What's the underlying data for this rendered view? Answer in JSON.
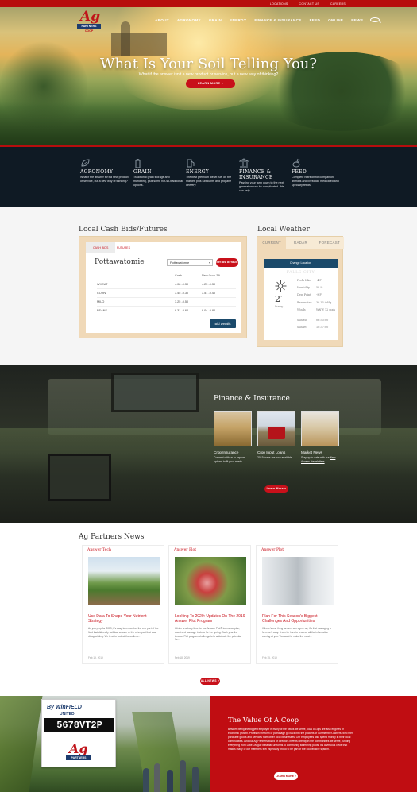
{
  "topbar": {
    "links": [
      "LOCATIONS",
      "CONTACT US",
      "CAREERS"
    ]
  },
  "brand": {
    "logo_text": "Ag",
    "logo_sub_a": "PARTNERS",
    "logo_sub_b": "COOP"
  },
  "nav": {
    "items": [
      "ABOUT",
      "AGRONOMY",
      "GRAIN",
      "ENERGY",
      "FINANCE & INSURANCE",
      "FEED",
      "ONLINE",
      "NEWS"
    ]
  },
  "hero": {
    "title": "What Is Your Soil Telling You?",
    "subtitle": "What if the answer isn't a new product or service, but a new way of thinking?",
    "button": "LEARN MORE »"
  },
  "services": [
    {
      "icon": "leaf-icon",
      "title": "AGRONOMY",
      "text": "What if the answer isn't a new product or service, but a new way of thinking?"
    },
    {
      "icon": "silo-icon",
      "title": "GRAIN",
      "text": "Traditional grain storage and marketing, plus some not-so-traditional options."
    },
    {
      "icon": "fuel-icon",
      "title": "ENERGY",
      "text": "The best premium diesel fuel on the market, plus lubricants and propane delivery."
    },
    {
      "icon": "bank-icon",
      "title": "FINANCE & INSURANCE",
      "text": "Passing your farm down to the next generation can be complicated. We can help."
    },
    {
      "icon": "rabbit-icon",
      "title": "FEED",
      "text": "Complete nutrition for companion animals and livestock, medicated and specialty feeds."
    }
  ],
  "cash": {
    "section_title": "Local Cash Bids/Futures",
    "tabs": [
      "CASH BIDS",
      "FUTURES"
    ],
    "location": "Pottawatomie",
    "select_value": "Pottawatomie",
    "set_default": "Set as default",
    "col_cash": "Cash",
    "col_new_crop": "New Crop '19",
    "rows": [
      {
        "crop": "WHEAT",
        "cash": "4.08 -0.30",
        "newcrop": "4.25 -0.30"
      },
      {
        "crop": "CORN",
        "cash": "3.45 -0.30",
        "newcrop": "3.51 -0.40"
      },
      {
        "crop": "MILO",
        "cash": "3.25 -0.50",
        "newcrop": ""
      },
      {
        "crop": "BEANS",
        "cash": "8.31 -0.60",
        "newcrop": "8.04 -0.80"
      }
    ],
    "bid_button": "Bid Details"
  },
  "weather": {
    "section_title": "Local Weather",
    "tabs": [
      "CURRENT",
      "RADAR",
      "FORECAST"
    ],
    "change_location": "Change Location",
    "city": "FALLS CITY",
    "temp": "2",
    "unit": "°",
    "condition": "Sunny",
    "stats": [
      {
        "k": "Feels Like",
        "v": "-4 F"
      },
      {
        "k": "Humidity",
        "v": "58 %"
      },
      {
        "k": "Dew Point",
        "v": "-9 F"
      },
      {
        "k": "Barometer",
        "v": "30.33 inHg"
      },
      {
        "k": "Winds",
        "v": "WNW 12 mph"
      },
      {
        "k": "Sunrise",
        "v": "06:53:00"
      },
      {
        "k": "Sunset",
        "v": "18:37:00"
      }
    ]
  },
  "finance": {
    "title": "Finance & Insurance",
    "cards": [
      {
        "title": "Crop Insurance",
        "text": "Connect with us to explore options to fit your needs."
      },
      {
        "title": "Crop Input Loans",
        "text": "2019 loans are now available."
      },
      {
        "title": "Market News",
        "text": "Stay up to date with our",
        "link": "New Access Newsletters"
      }
    ],
    "button": "Learn More »"
  },
  "news": {
    "section_title": "Ag Partners News",
    "cards": [
      {
        "category": "Answer Tech",
        "title": "Use Data To Shape Your Nutrient Strategy",
        "text": "As you prep for 2019, it's easy to remember the one part of the field that did really well last season or the other part that was disappointing. We tend to look at the outliers...",
        "date": "Feb 19, 2019"
      },
      {
        "category": "Answer Plot",
        "title": "Looking To 2020: Updates On The 2019 Answer Plot Program",
        "text": "Winter is a busy time for our Answer Plot® teams we plan, count and package trials to for the spring. Each year the Answer Plot program challenge is to anticipate the potential for...",
        "date": "Feb 18, 2019"
      },
      {
        "category": "Answer Plot",
        "title": "Plan For This Season's Biggest Challenges And Opportunities",
        "text": "If there's one thing farmers can agree on, it's that managing a farm isn't easy. It can be hard to process all the information coming at you. You want to make the most...",
        "date": "Feb 15, 2019"
      }
    ],
    "all_button": "ALL NEWS »"
  },
  "coop": {
    "sign_by": "By WinFIELD",
    "sign_united": "UNITED",
    "sign_code": "5678VT2P",
    "title": "The Value Of A Coop",
    "text": "Besides being the biggest employer in many of the towns we serve, local co-ops are also engines of economic growth. Profits in the form of patronage go back into the pockets of our member-owners, who then purchase goods and services from other local businesses. Our employees also spend money in their local communities. And our Ag Partners board of directors invests directly in the communities we serve, funding everything from Little League baseball uniforms to community swimming pools. It's a virtuous cycle that makes many of our members feel especially proud to be part of the cooperative system.",
    "button": "LEARN MORE »"
  }
}
